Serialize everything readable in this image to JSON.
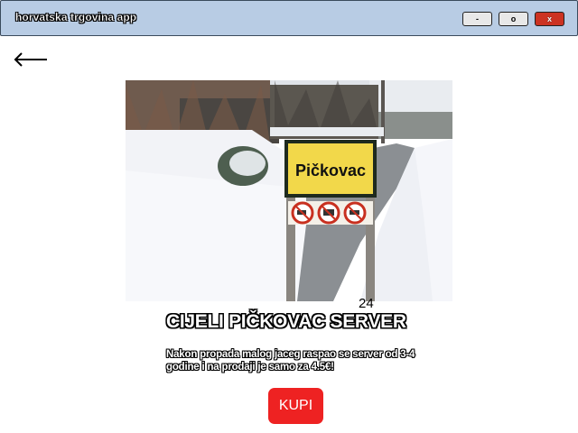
{
  "window": {
    "title": "horvatska trgovina app",
    "minimize_label": "-",
    "maximize_label": "o",
    "close_label": "x"
  },
  "navigation": {
    "back_icon": "left-arrow-icon"
  },
  "product": {
    "image_sign_text": "Pičkovac",
    "count": "24",
    "title": "CIJELI PIČKOVAC SERVER",
    "description": "Nakon propada malog jaceg raspao se server od 3-4 godine i na prodaji je samo za 4.5€!",
    "buy_label": "KUPI"
  },
  "colors": {
    "titlebar": "#b8cce4",
    "buy_button": "#ee2222",
    "close_button": "#cc3322"
  }
}
